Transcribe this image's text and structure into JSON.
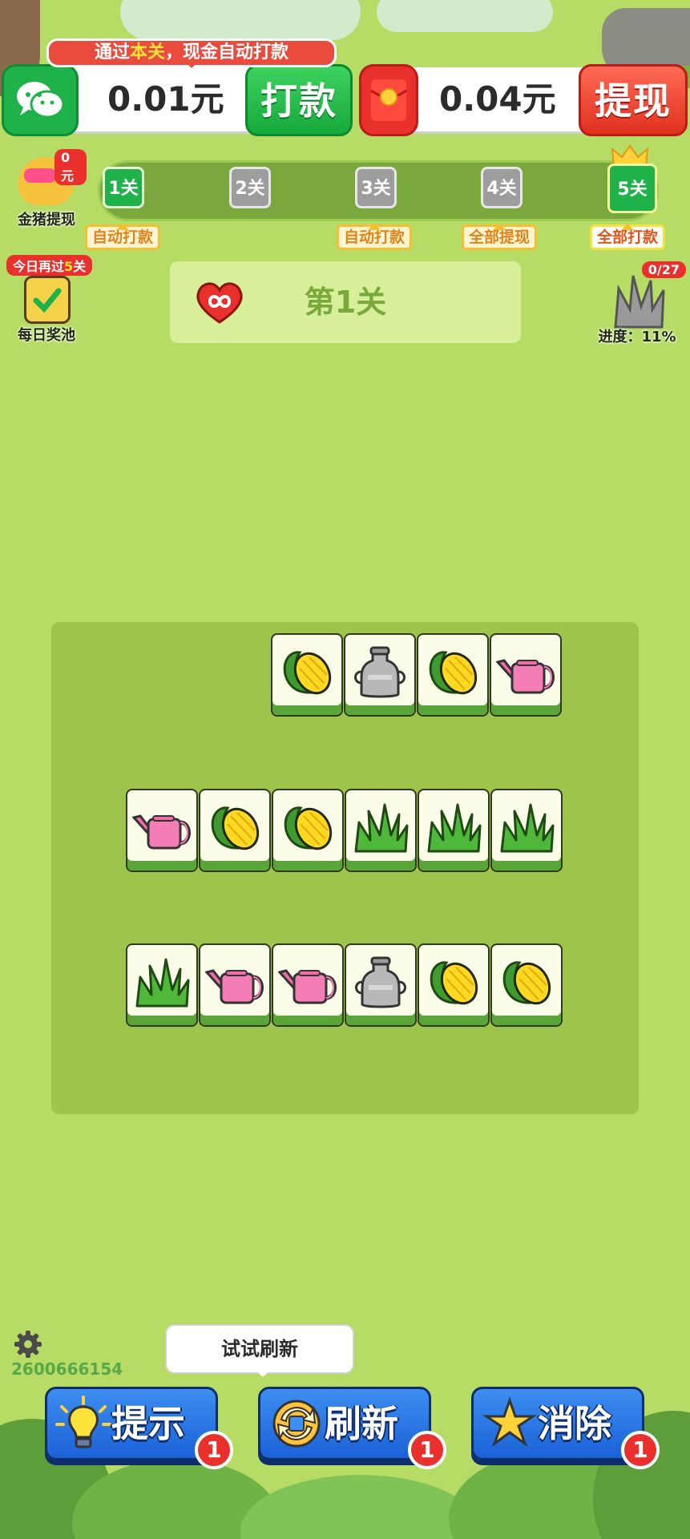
{
  "promo": {
    "pre": "通过",
    "highlight": "本关",
    "post": "，现金自动打款"
  },
  "wallet": {
    "wechat_amount": "0.01元",
    "pay_label": "打款",
    "redpack_amount": "0.04元",
    "withdraw_label": "提现"
  },
  "pig": {
    "badge": "0元",
    "label": "金猪提现"
  },
  "levels": [
    {
      "label": "1关",
      "tag": "自动打款"
    },
    {
      "label": "2关",
      "tag": ""
    },
    {
      "label": "3关",
      "tag": "自动打款"
    },
    {
      "label": "4关",
      "tag": "全部提现"
    },
    {
      "label": "5关",
      "tag": "全部打款"
    }
  ],
  "pool": {
    "badge_pre": "今日再过",
    "badge_num": "5",
    "badge_post": "关",
    "label": "每日奖池"
  },
  "stage": {
    "title": "第1关"
  },
  "progress": {
    "count": "0/27",
    "label": "进度：11%"
  },
  "board": {
    "rows": [
      [
        "corn",
        "milk-can",
        "corn",
        "watering-can"
      ],
      [
        "watering-can",
        "corn",
        "corn",
        "grass",
        "grass",
        "grass"
      ],
      [
        "grass",
        "watering-can",
        "watering-can",
        "milk-can",
        "corn",
        "corn"
      ]
    ]
  },
  "tooltip": "试试刷新",
  "user_id": "2600666154",
  "tools": [
    {
      "label": "提示",
      "count": "1",
      "icon": "lightbulb-icon"
    },
    {
      "label": "刷新",
      "count": "1",
      "icon": "refresh-icon"
    },
    {
      "label": "消除",
      "count": "1",
      "icon": "star-icon"
    }
  ],
  "colors": {
    "background": "#b6dc66",
    "board": "#9fc44c",
    "tile_base": "#5aa53a",
    "tool_button": "#1a61d6",
    "badge": "#e9302c"
  }
}
